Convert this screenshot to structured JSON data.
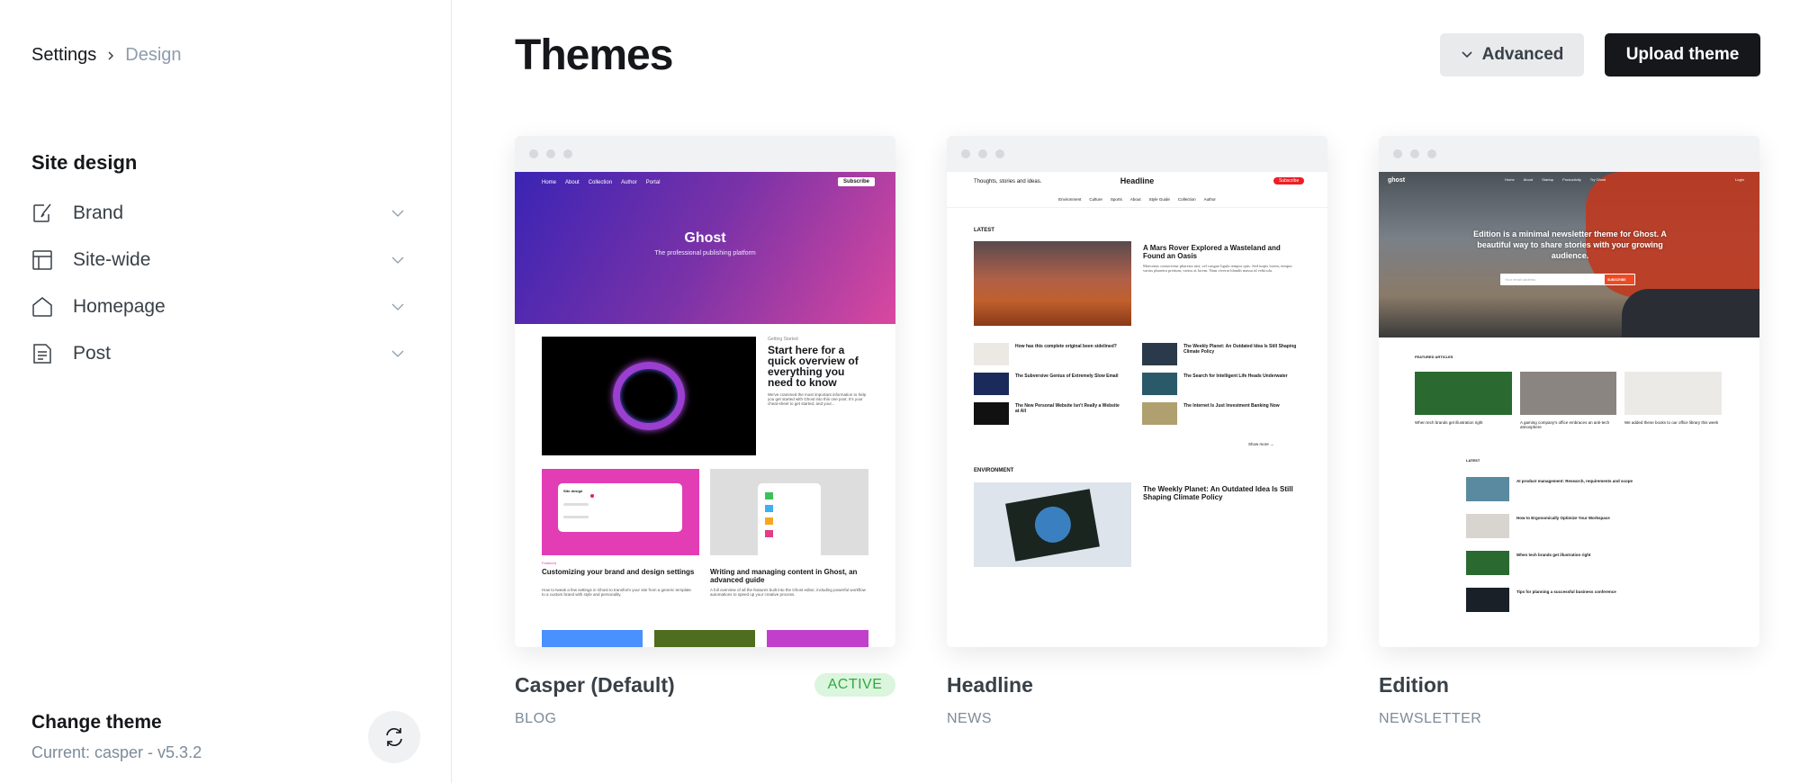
{
  "sidebar": {
    "breadcrumb": {
      "parent": "Settings",
      "current": "Design"
    },
    "section_title": "Site design",
    "items": [
      {
        "label": "Brand",
        "icon": "brush-icon"
      },
      {
        "label": "Site-wide",
        "icon": "layout-icon"
      },
      {
        "label": "Homepage",
        "icon": "home-icon"
      },
      {
        "label": "Post",
        "icon": "document-icon"
      }
    ],
    "change_theme": {
      "title": "Change theme",
      "current": "Current: casper - v5.3.2"
    }
  },
  "main": {
    "title": "Themes",
    "advanced_label": "Advanced",
    "upload_label": "Upload theme",
    "themes": [
      {
        "name": "Casper (Default)",
        "category": "BLOG",
        "badge": "ACTIVE"
      },
      {
        "name": "Headline",
        "category": "NEWS"
      },
      {
        "name": "Edition",
        "category": "NEWSLETTER"
      }
    ]
  },
  "previews": {
    "casper": {
      "nav": [
        "Home",
        "About",
        "Collection",
        "Author",
        "Portal"
      ],
      "subscribe": "Subscribe",
      "title": "Ghost",
      "tagline": "The professional publishing platform",
      "feature_tag": "Getting Started",
      "feature_title": "Start here for a quick overview of everything you need to know",
      "feature_excerpt": "We've crammed the most important information to help you get started with Ghost into this one post. It's your cheat-sheet to get started, and your...",
      "card1_title": "Customizing your brand and design settings",
      "card1_excerpt": "How to tweak a few settings in Ghost to transform your site from a generic template to a custom brand with style and personality.",
      "card2_title": "Writing and managing content in Ghost, an advanced guide",
      "card2_excerpt": "A full overview of all the features built into the Ghost editor, including powerful workflow automations to speed up your creative process.",
      "site_design": "Site design",
      "featured": "Featured"
    },
    "headline": {
      "tagline": "Thoughts, stories and ideas.",
      "title": "Headline",
      "subscribe": "Subscribe",
      "nav": [
        "Environment",
        "Culture",
        "Sports",
        "About",
        "Style Guide",
        "Collection",
        "Author"
      ],
      "latest": "LATEST",
      "main_title": "A Mars Rover Explored a Wasteland and Found an Oasis",
      "excerpt": "Maecenas consectetur pharetra nisi, vel congue ligula tempor quis. Sed turpis lorem, tempor varius pharetra pretium, varius at lorem. Nam viverra blandit massa id vehicula.",
      "list": [
        "How has this complete original been sidelined?",
        "The Weekly Planet: An Outdated Idea Is Still Shaping Climate Policy",
        "The Subversive Genius of Extremely Slow Email",
        "The Search for Intelligent Life Heads Underwater",
        "The New Personal Website Isn't Really a Website at All",
        "The Internet Is Just Investment Banking Now"
      ],
      "show_more": "Show more →",
      "environment": "ENVIRONMENT",
      "env_title": "The Weekly Planet: An Outdated Idea Is Still Shaping Climate Policy"
    },
    "edition": {
      "logo": "ghost",
      "nav": [
        "Home",
        "About",
        "Startup",
        "Productivity",
        "Try Ghost"
      ],
      "login": "Login",
      "hero": "Edition is a minimal newsletter theme for Ghost. A beautiful way to share stories with your growing audience.",
      "email_placeholder": "Your email address",
      "subscribe": "SUBSCRIBE",
      "featured": "FEATURED ARTICLES",
      "featured_items": [
        "When tech brands get illustration right",
        "A gaming company's office embraces an anti-tech atmosphere",
        "We added these books to our office library this week"
      ],
      "latest": "LATEST",
      "latest_items": [
        "AI product management: Research, requirements and scope",
        "How to Ergonomically Optimize Your Workspace",
        "When tech brands get illustration right",
        "Tips for planning a successful business conference"
      ]
    }
  },
  "colors": {
    "active_badge_bg": "#dcf5de",
    "active_badge_text": "#30a93e",
    "primary_button": "#15171a"
  }
}
